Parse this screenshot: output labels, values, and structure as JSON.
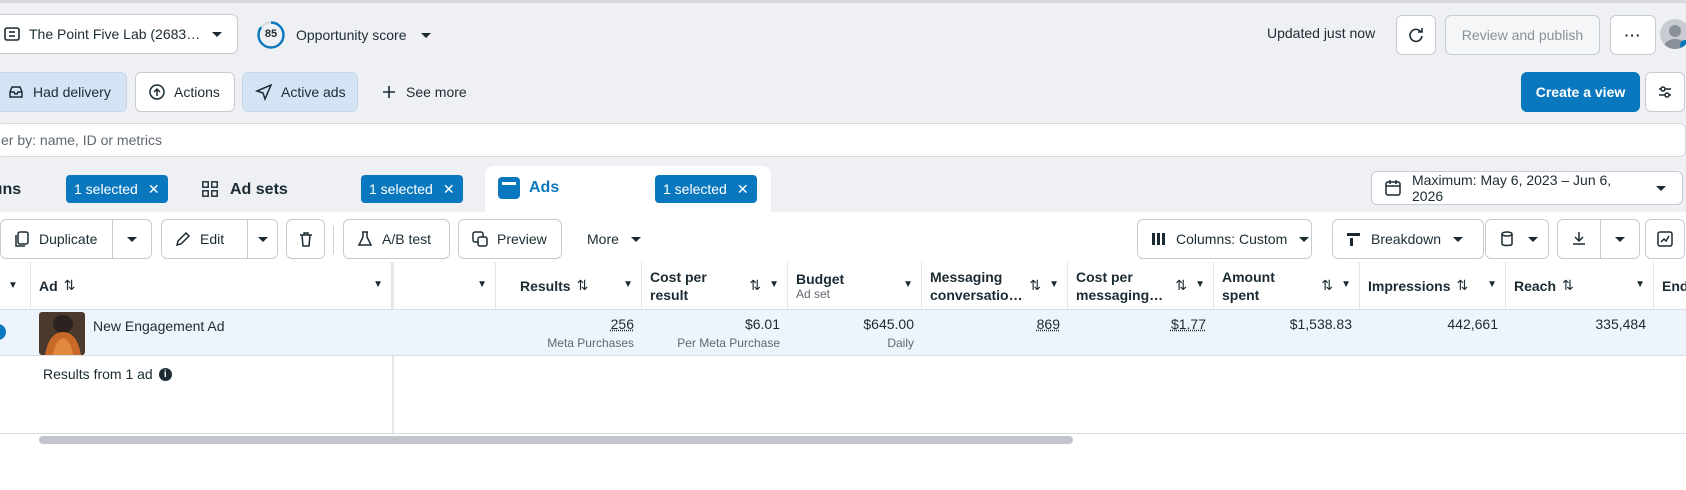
{
  "header": {
    "account_name": "The Point Five Lab (2683…",
    "opportunity_score": "85",
    "opportunity_label": "Opportunity score",
    "updated_text": "Updated just now",
    "review_publish": "Review and publish",
    "more_dots": "···"
  },
  "filters": {
    "had_delivery": "Had delivery",
    "actions": "Actions",
    "active_ads": "Active ads",
    "see_more": "See more",
    "create_view": "Create a view"
  },
  "search": {
    "placeholder": "er by: name, ID or metrics"
  },
  "tabs": {
    "campaigns_partial": "ıns",
    "campaigns_selected": "1 selected",
    "adsets": "Ad sets",
    "adsets_selected": "1 selected",
    "ads": "Ads",
    "ads_selected": "1 selected"
  },
  "date_range": "Maximum: May 6, 2023 – Jun 6, 2026",
  "toolbar": {
    "duplicate": "Duplicate",
    "edit": "Edit",
    "ab_test": "A/B test",
    "preview": "Preview",
    "more": "More",
    "columns": "Columns: Custom",
    "breakdown": "Breakdown"
  },
  "table": {
    "headers": {
      "ad": "Ad",
      "results": "Results",
      "cost_per_result": "Cost per result",
      "budget": "Budget",
      "budget_sub": "Ad set",
      "messaging": "Messaging conversatio…",
      "cost_per_messaging": "Cost per messaging…",
      "amount_spent": "Amount spent",
      "impressions": "Impressions",
      "reach": "Reach",
      "ends": "End"
    },
    "row": {
      "ad_name": "New Engagement Ad",
      "results": "256",
      "results_sub": "Meta Purchases",
      "cost_per_result": "$6.01",
      "cost_per_result_sub": "Per Meta Purchase",
      "budget": "$645.00",
      "budget_sub": "Daily",
      "messaging": "869",
      "cost_per_messaging": "$1.77",
      "amount_spent": "$1,538.83",
      "impressions": "442,661",
      "reach": "335,484"
    },
    "footer": "Results from 1 ad"
  },
  "colors": {
    "accent": "#0a78be",
    "pill": "#d5e4f5"
  }
}
